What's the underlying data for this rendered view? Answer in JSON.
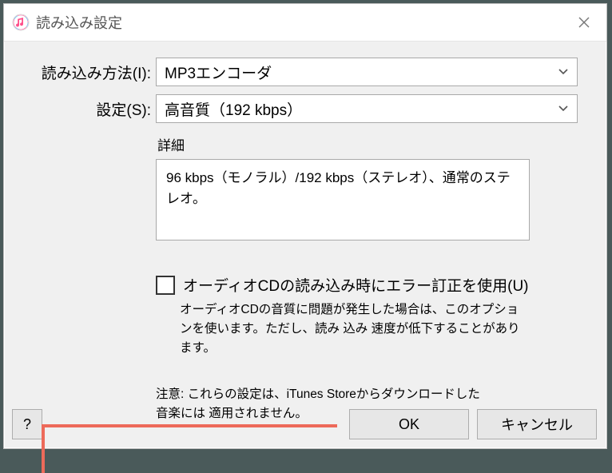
{
  "window": {
    "title": "読み込み設定"
  },
  "form": {
    "import_method_label": "読み込み方法(I):",
    "import_method_value": "MP3エンコーダ",
    "setting_label": "設定(S):",
    "setting_value": "高音質（192 kbps）",
    "detail_heading": "詳細",
    "detail_text": "96 kbps（モノラル）/192 kbps（ステレオ）、通常のステレオ。",
    "error_correction_label": "オーディオCDの読み込み時にエラー訂正を使用(U)",
    "error_correction_note": "オーディオCDの音質に問題が発生した場合は、このオプションを使います。ただし、読み 込み 速度が低下することがあります。",
    "store_note": "注意: これらの設定は、iTunes Storeからダウンロードした\n音楽には 適用されません。"
  },
  "buttons": {
    "help": "?",
    "ok": "OK",
    "cancel": "キャンセル"
  }
}
